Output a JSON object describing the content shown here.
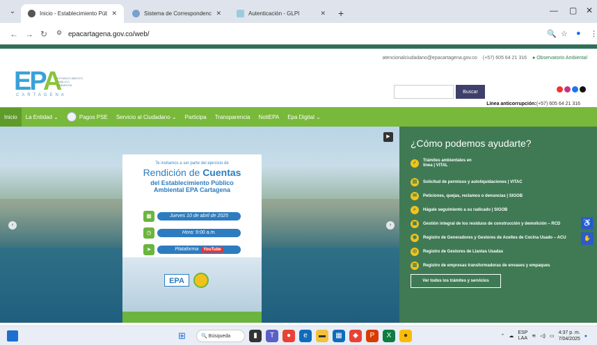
{
  "browser": {
    "tabs": [
      {
        "title": "Inicio - Establecimiento Público",
        "active": true
      },
      {
        "title": "Sistema de Correspondencia",
        "active": false
      },
      {
        "title": "Autenticación - GLPI",
        "active": false
      }
    ],
    "url": "epacartagena.gov.co/web/"
  },
  "header": {
    "email": "atencionalciudadano@epacartagena.gov.co",
    "phone": "(+57) 605 64 21 316",
    "observatorio": "Observatorio Ambiental",
    "logo_text_ep": "EP",
    "logo_text_a": "A",
    "logo_sub": "ESTABLECIMIENTO PÚBLICO AMBIENTAL",
    "logo_city": "CARTAGENA",
    "search_button": "Buscar",
    "anticorruption_label": "Línea anticorrupción:",
    "anticorruption_phone": "(+57) 605 64 21 316"
  },
  "nav": {
    "items": [
      "Inicio",
      "La Entidad",
      "Pagos PSE",
      "Servicio al Ciudadano",
      "Participa",
      "Transparencia",
      "NotiEPA",
      "Epa Digital"
    ]
  },
  "flyer": {
    "invite": "Te invitamos a ser parte del ejercicio de",
    "title_a": "Rendición de ",
    "title_b": "Cuentas",
    "sub1": "del Establecimiento Público",
    "sub2": "Ambiental EPA Cartagena",
    "date": "Jueves 10 de abril de 2025",
    "hour": "Hora: 9:00 a.m.",
    "platform": "Plataforma",
    "youtube": "YouTube",
    "epa": "EPA"
  },
  "help": {
    "title": "¿Cómo podemos ayudarte?",
    "items": [
      "Trámites ambientales en línea | VITAL",
      "Solicitud de permisos y autoliquidaciones | VITAC",
      "Peticiones, quejas, reclamos o denuncias | SIGOB",
      "Hágale seguimiento a su radicado | SIGOB",
      "Gestión integral de los residuos de construcción y demolición – RCD",
      "Registro de Generadores y Gestores de Aceites de Cocina Usado – ACU",
      "Registro de Gestores de Llantas Usadas",
      "Registro de empresas transformadoras de envases y empaques"
    ],
    "button": "Ver todos los trámites y servicios"
  },
  "taskbar": {
    "search": "Búsqueda",
    "lang1": "ESP",
    "lang2": "LAA",
    "time": "4:37 p. m.",
    "date": "7/04/2025"
  },
  "colors": {
    "nav_green": "#78b83a",
    "help_green": "#3f7a55",
    "brand_blue": "#3aa1d8"
  }
}
